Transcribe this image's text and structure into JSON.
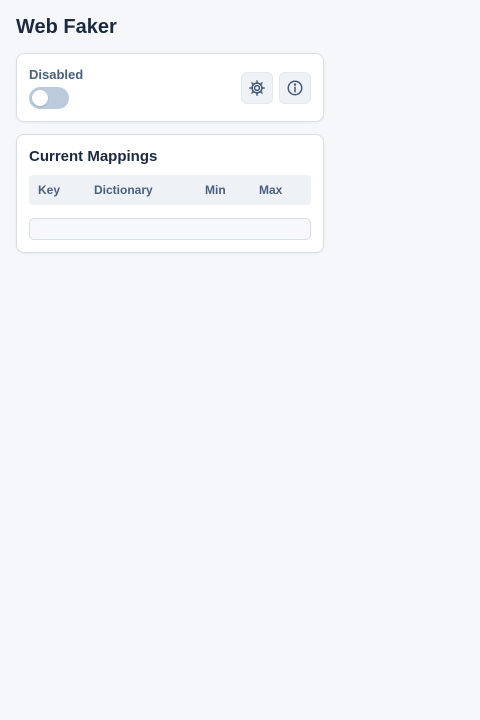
{
  "app": {
    "title": "Web Faker"
  },
  "status": {
    "label": "Disabled",
    "enabled": false
  },
  "icons": {
    "settings": "gear-icon",
    "info": "info-icon"
  },
  "mappings": {
    "title": "Current Mappings",
    "columns": [
      "Key",
      "Dictionary",
      "Min",
      "Max"
    ],
    "rows": []
  },
  "colors": {
    "background": "#f5f7fb",
    "accent_text": "#4a607e",
    "toggle_off": "#bccbdc"
  }
}
